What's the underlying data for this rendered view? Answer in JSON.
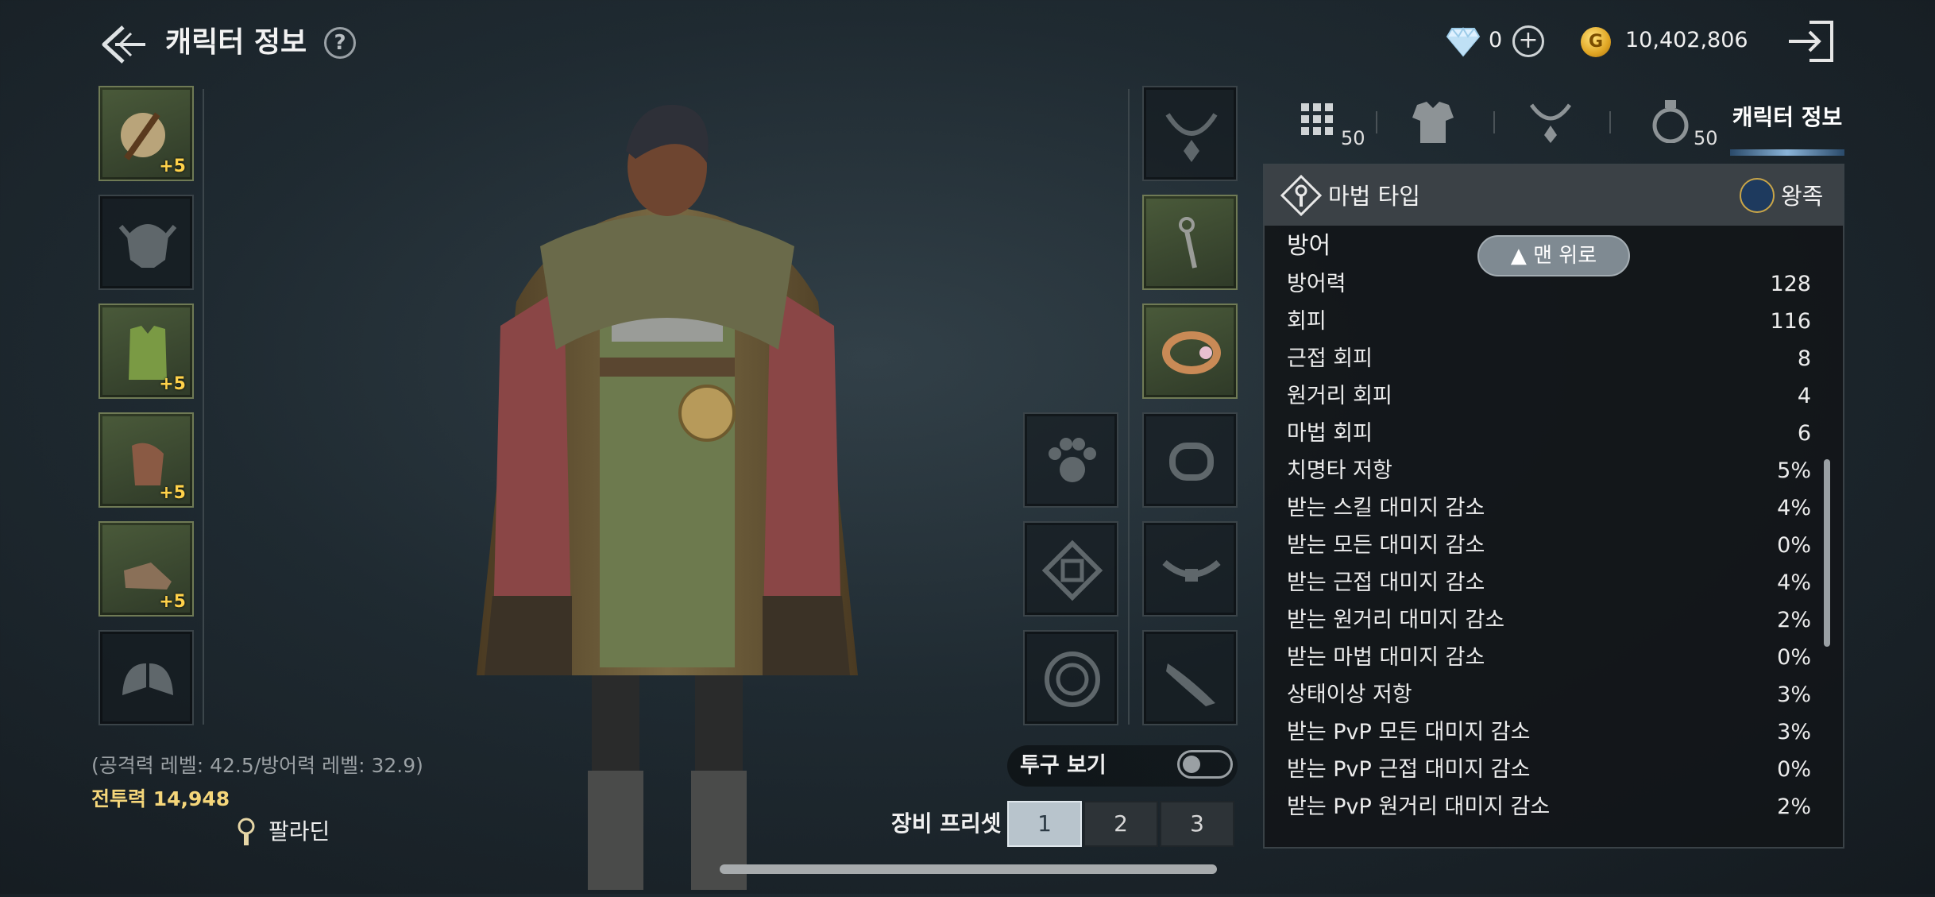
{
  "header": {
    "title": "캐릭터 정보",
    "help_icon": "?",
    "diamond_count": "0",
    "gold_amount": "10,402,806",
    "gold_icon_letter": "G"
  },
  "left_slots": [
    {
      "name": "weapon-slot",
      "icon": "staff-icon",
      "enchant": "+5",
      "filled": true
    },
    {
      "name": "helmet-slot",
      "icon": "helmet-icon",
      "enchant": "",
      "filled": false
    },
    {
      "name": "armor-slot",
      "icon": "vest-icon",
      "enchant": "+5",
      "filled": true
    },
    {
      "name": "gloves-slot",
      "icon": "gloves-icon",
      "enchant": "+5",
      "filled": true
    },
    {
      "name": "boots-slot",
      "icon": "boots-icon",
      "enchant": "+5",
      "filled": true
    },
    {
      "name": "cloak-slot",
      "icon": "wings-icon",
      "enchant": "",
      "filled": false
    }
  ],
  "right_slots_outer": [
    {
      "name": "necklace-slot",
      "icon": "necklace-icon",
      "filled": false
    },
    {
      "name": "earring-slot",
      "icon": "earring-icon",
      "filled": true
    },
    {
      "name": "ring-slot",
      "icon": "ring-icon",
      "filled": true
    },
    {
      "name": "bracelet-slot",
      "icon": "bracelet-icon",
      "filled": false
    },
    {
      "name": "belt-slot",
      "icon": "belt-icon",
      "filled": false
    },
    {
      "name": "horn-slot",
      "icon": "horn-icon",
      "filled": false
    }
  ],
  "right_slots_inner": [
    {
      "name": "paw-slot",
      "icon": "paw-icon"
    },
    {
      "name": "emblem-slot",
      "icon": "knot-icon"
    },
    {
      "name": "coin-slot",
      "icon": "coin-icon"
    }
  ],
  "character": {
    "levels": "(공격력 레벨: 42.5/방어력 레벨: 32.9)",
    "combat_power": "전투력  14,948",
    "class_name": "팔라딘"
  },
  "helmet_toggle": {
    "label": "투구 보기",
    "on": false
  },
  "preset": {
    "label": "장비 프리셋",
    "options": [
      "1",
      "2",
      "3"
    ],
    "active": "1"
  },
  "tabs": {
    "inventory_count": "50",
    "potion_count": "50",
    "active_label": "캐릭터 정보"
  },
  "panel": {
    "header_title": "마법 타입",
    "faction": "왕족",
    "section": "방어",
    "to_top_label": "▲ 맨 위로",
    "rows": [
      {
        "name": "방어력",
        "value": "128"
      },
      {
        "name": "회피",
        "value": "116"
      },
      {
        "name": "근접 회피",
        "value": "8"
      },
      {
        "name": "원거리 회피",
        "value": "4"
      },
      {
        "name": "마법 회피",
        "value": "6"
      },
      {
        "name": "치명타 저항",
        "value": "5%"
      },
      {
        "name": "받는 스킬 대미지 감소",
        "value": "4%"
      },
      {
        "name": "받는 모든 대미지 감소",
        "value": "0%"
      },
      {
        "name": "받는 근접 대미지 감소",
        "value": "4%"
      },
      {
        "name": "받는 원거리 대미지 감소",
        "value": "2%"
      },
      {
        "name": "받는 마법 대미지 감소",
        "value": "0%"
      },
      {
        "name": "상태이상 저항",
        "value": "3%"
      },
      {
        "name": "받는 PvP 모든 대미지 감소",
        "value": "3%"
      },
      {
        "name": "받는 PvP 근접 대미지 감소",
        "value": "0%"
      },
      {
        "name": "받는 PvP 원거리 대미지 감소",
        "value": "2%"
      }
    ]
  },
  "colors": {
    "accent_gold": "#f5d67a",
    "enchant_yellow": "#ffd24a",
    "active_preset": "#b8c4cc",
    "panel_bg": "#121619"
  }
}
